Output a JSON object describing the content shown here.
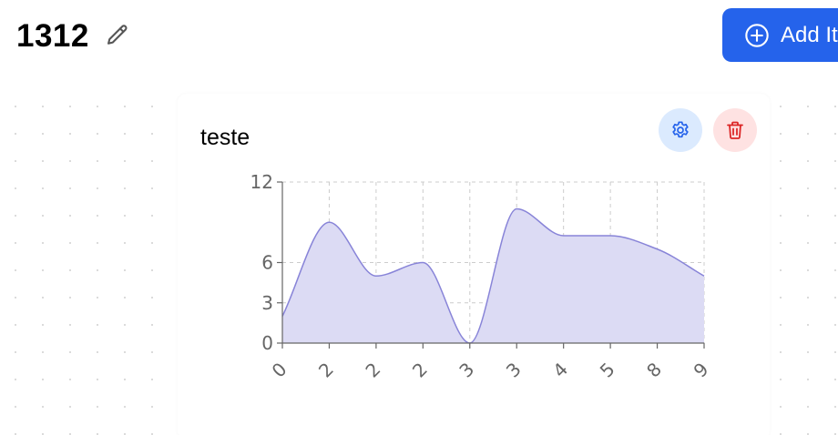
{
  "header": {
    "dashboard_title": "1312",
    "add_button_label": "Add It",
    "edit_icon": "pencil-icon",
    "add_icon": "plus-circle-icon"
  },
  "card": {
    "title": "teste",
    "settings_icon": "gear-icon",
    "delete_icon": "trash-icon"
  },
  "colors": {
    "primary": "#2563eb",
    "settings_bg": "#dbeafe",
    "settings_fg": "#2563eb",
    "delete_bg": "#fee2e2",
    "delete_fg": "#dc2626",
    "series_stroke": "#8884d8",
    "series_fill": "#dcdbf4"
  },
  "chart_data": {
    "type": "area",
    "x": [
      "0",
      "2",
      "2",
      "2",
      "3",
      "3",
      "4",
      "5",
      "8",
      "9"
    ],
    "values": [
      2,
      9,
      5,
      6,
      0,
      10,
      8,
      8,
      7,
      5
    ],
    "ylim": [
      0,
      12
    ],
    "yticks": [
      0,
      3,
      6,
      12
    ],
    "grid": true,
    "smooth": true
  }
}
